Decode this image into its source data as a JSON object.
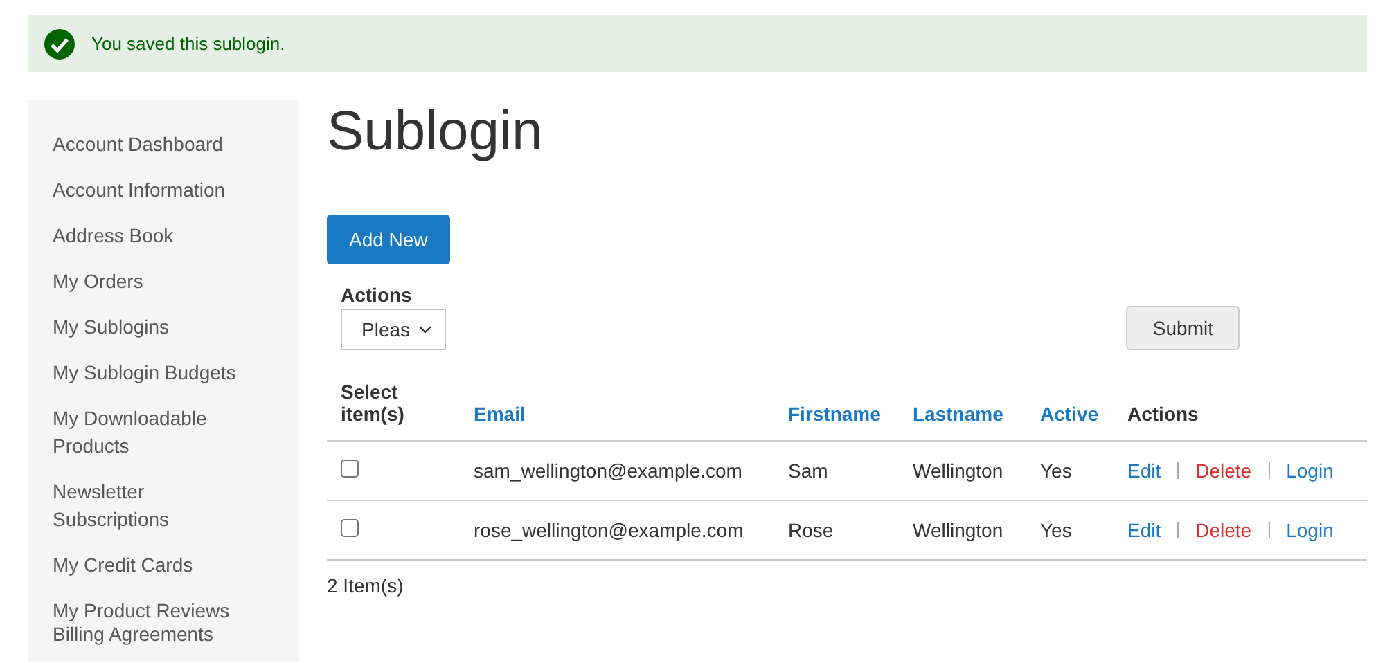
{
  "message": {
    "text": "You saved this sublogin."
  },
  "sidebar": {
    "items": [
      {
        "label": "Account Dashboard"
      },
      {
        "label": "Account Information"
      },
      {
        "label": "Address Book"
      },
      {
        "label": "My Orders"
      },
      {
        "label": "My Sublogins"
      },
      {
        "label": "My Sublogin Budgets"
      },
      {
        "label": "My Downloadable Products"
      },
      {
        "label": "Newsletter Subscriptions"
      },
      {
        "label": "My Credit Cards"
      },
      {
        "label": "My Product Reviews"
      },
      {
        "label": "Billing Agreements"
      }
    ]
  },
  "page_title": "Sublogin",
  "add_button": "Add New",
  "mass_action": {
    "label": "Actions",
    "value": "Pleas",
    "submit": "Submit"
  },
  "table": {
    "columns": [
      {
        "label": "Select item(s)",
        "kind": "plain"
      },
      {
        "label": "Email",
        "kind": "sortable"
      },
      {
        "label": "Firstname",
        "kind": "sortable"
      },
      {
        "label": "Lastname",
        "kind": "sortable"
      },
      {
        "label": "Active",
        "kind": "sortable"
      },
      {
        "label": "Actions",
        "kind": "plain"
      }
    ],
    "rows": [
      {
        "checked": false,
        "email": "sam_wellington@example.com",
        "firstname": "Sam",
        "lastname": "Wellington",
        "active": "Yes",
        "actions": [
          {
            "label": "Edit",
            "kind": "edit"
          },
          {
            "label": "Delete",
            "kind": "delete"
          },
          {
            "label": "Login",
            "kind": "login"
          }
        ]
      },
      {
        "checked": false,
        "email": "rose_wellington@example.com",
        "firstname": "Rose",
        "lastname": "Wellington",
        "active": "Yes",
        "actions": [
          {
            "label": "Edit",
            "kind": "edit"
          },
          {
            "label": "Delete",
            "kind": "delete"
          },
          {
            "label": "Login",
            "kind": "login"
          }
        ]
      }
    ]
  },
  "count": "2 Item(s)"
}
